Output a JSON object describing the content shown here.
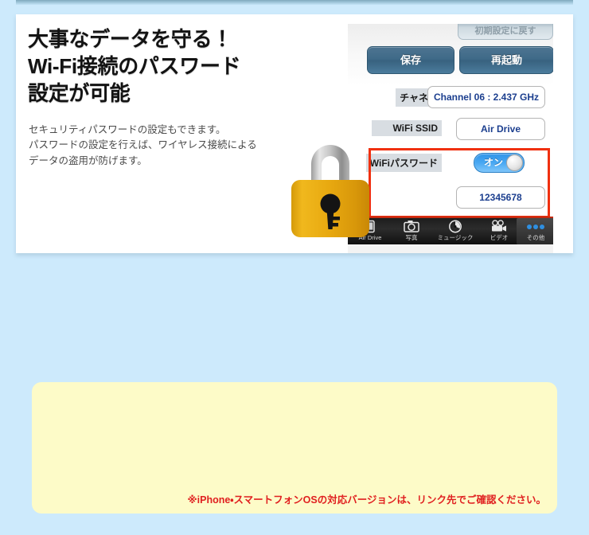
{
  "hero": {
    "headline_lines": [
      "大事なデータを守る！",
      "Wi-Fi接続のパスワード",
      "設定が可能"
    ],
    "subcopy_lines": [
      "セキュリティパスワードの設定もできます。",
      "パスワードの設定を行えば、ワイヤレス接続による",
      "データの盗用が防げます。"
    ],
    "lock_icon": "padlock-icon"
  },
  "device": {
    "cut_button_label": "初期設定に戻す",
    "buttons": {
      "save_label": "保存",
      "reboot_label": "再起動"
    },
    "rows": [
      {
        "label": "チャネル",
        "value": "Channel 06 : 2.437 GHz"
      },
      {
        "label": "WiFi SSID",
        "value": "Air Drive"
      },
      {
        "label": "WiFiパスワード",
        "value": ""
      },
      {
        "label": "",
        "value": "12345678"
      }
    ],
    "toggle": {
      "state_label": "オン",
      "on_color": "#49a8f2"
    },
    "highlight_color": "#f03010",
    "tabbar": [
      {
        "label": "Air Drive",
        "icon": "device-icon"
      },
      {
        "label": "写真",
        "icon": "camera-icon"
      },
      {
        "label": "ミュージック",
        "icon": "music-icon"
      },
      {
        "label": "ビデオ",
        "icon": "video-camera-icon"
      },
      {
        "label": "その他",
        "icon": "more-dots-icon"
      }
    ]
  },
  "note": {
    "text": "※iPhone・スマートフォンOSの対応バージョンは、リンク先でご確認ください。",
    "background": "#fdfbc8",
    "text_color": "#e02020"
  },
  "theme": {
    "page_background": "#cdeafc",
    "card_background": "#ffffff",
    "accent_blue": "#3f6a88"
  }
}
